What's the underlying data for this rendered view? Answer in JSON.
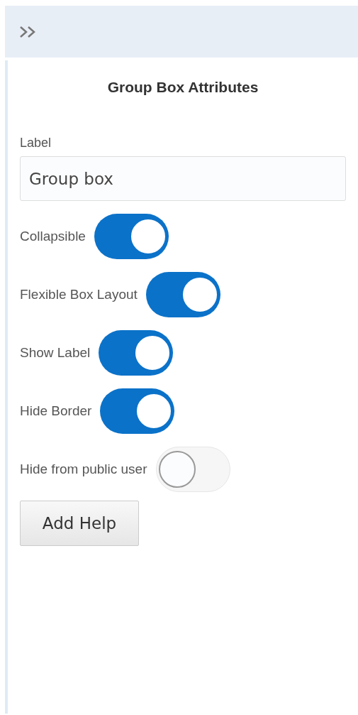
{
  "title": "Group Box Attributes",
  "label_field": {
    "label": "Label",
    "value": "Group box"
  },
  "toggles": [
    {
      "label": "Collapsible",
      "on": true
    },
    {
      "label": "Flexible Box Layout",
      "on": true
    },
    {
      "label": "Show Label",
      "on": true
    },
    {
      "label": "Hide Border",
      "on": true
    },
    {
      "label": "Hide from public user",
      "on": false
    }
  ],
  "button": "Add Help"
}
